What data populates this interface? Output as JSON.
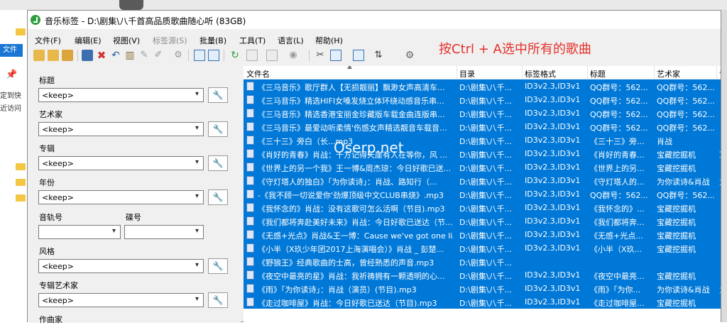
{
  "window": {
    "title": "音乐标签 - D:\\剧集\\八千首高品质歌曲随心听 (83GB)"
  },
  "menu": [
    {
      "label": "文件(F)",
      "enabled": true
    },
    {
      "label": "编辑(E)",
      "enabled": true
    },
    {
      "label": "视图(V)",
      "enabled": true
    },
    {
      "label": "标签源(S)",
      "enabled": false
    },
    {
      "label": "批量(B)",
      "enabled": true
    },
    {
      "label": "工具(T)",
      "enabled": true
    },
    {
      "label": "语言(L)",
      "enabled": true
    },
    {
      "label": "帮助(H)",
      "enabled": true
    }
  ],
  "toolbar_icons": [
    "open-folder-icon",
    "add-folder-icon",
    "folders-icon",
    "save-icon",
    "remove-icon",
    "undo-icon",
    "book-icon",
    "tag-icon",
    "pencil-icon",
    "gear-icon",
    "grid-icon",
    "table-icon",
    "refresh-icon",
    "list-icon",
    "column-icon",
    "cd-icon",
    "wrench-icon",
    "copy-icon",
    "export-icon",
    "import-icon",
    "settings-icon"
  ],
  "fields": {
    "title": {
      "label": "标题",
      "value": "<keep>"
    },
    "artist": {
      "label": "艺术家",
      "value": "<keep>"
    },
    "album": {
      "label": "专辑",
      "value": "<keep>"
    },
    "year": {
      "label": "年份",
      "value": "<keep>"
    },
    "track": {
      "label": "音轨号"
    },
    "disc": {
      "label": "碟号"
    },
    "genre": {
      "label": "风格",
      "value": "<keep>"
    },
    "album_artist": {
      "label": "专辑艺术家",
      "value": "<keep>"
    },
    "composer": {
      "label": "作曲家"
    }
  },
  "filelist": {
    "columns": [
      "文件名",
      "目录",
      "标签格式",
      "标题",
      "艺术家",
      "专"
    ],
    "rows": [
      {
        "name": "《三马音乐》歌厅群人【无损靓丽】飘渺女声高清车...",
        "dir": "D:\\剧集\\八千...",
        "fmt": "ID3v2.3,ID3v1",
        "title": "QQ群号：562...",
        "artist": "QQ群号：562...",
        "album": "",
        "selected": true
      },
      {
        "name": "《三马音乐》精选HIFI女嗓发烧立体环绕动感音乐串...",
        "dir": "D:\\剧集\\八千...",
        "fmt": "ID3v2.3,ID3v1",
        "title": "QQ群号：562...",
        "artist": "QQ群号：562...",
        "album": "",
        "selected": true
      },
      {
        "name": "《三马音乐》精选香港宝丽金珍藏版车载金曲连版串...",
        "dir": "D:\\剧集\\八千...",
        "fmt": "ID3v2.3,ID3v1",
        "title": "QQ群号：562...",
        "artist": "QQ群号：562...",
        "album": "",
        "selected": true
      },
      {
        "name": "《三马音乐》最爱动听柔情'伤感女声精选靓音车载音...",
        "dir": "D:\\剧集\\八千...",
        "fmt": "ID3v2.3,ID3v1",
        "title": "QQ群号：562...",
        "artist": "QQ群号：562...",
        "album": "",
        "selected": true
      },
      {
        "name": "《三十三》旁白（长...mp3",
        "dir": "D:\\剧集\\八千...",
        "fmt": "ID3v2.3,ID3v1",
        "title": "《三十三》旁...",
        "artist": "肖战",
        "album": "",
        "selected": true
      },
      {
        "name": "《肖好的青春》肖战：千方记得天崖有人在等你，风 ...",
        "dir": "D:\\剧集\\八千...",
        "fmt": "ID3v2.3,ID3v1",
        "title": "《肖好的青春...",
        "artist": "宝藏挖掘机",
        "album": "耳",
        "selected": true
      },
      {
        "name": "《世界上的另一个我》王一博&周杰琼：今日好歌已送...",
        "dir": "D:\\剧集\\八千...",
        "fmt": "ID3v2.3,ID3v1",
        "title": "《世界上的另...",
        "artist": "宝藏挖掘机",
        "album": "",
        "selected": true
      },
      {
        "name": "《守灯塔人的独白》「为你读诗」：肖战、路知行（...",
        "dir": "D:\\剧集\\八千...",
        "fmt": "ID3v2.3,ID3v1",
        "title": "《守灯塔人的...",
        "artist": "为你读诗&肖战",
        "album": "为",
        "selected": true
      },
      {
        "name": "-《我不顾一切说爱你'劲爆顶级中文CLUB串烧》.mp3",
        "dir": "D:\\剧集\\八千...",
        "fmt": "ID3v2.3,ID3v1",
        "title": "QQ群号：562...",
        "artist": "QQ群号：562...",
        "album": "",
        "selected": true
      },
      {
        "name": "《我怀念的》肖战：没有这歌可怎么活啊（节目).mp3",
        "dir": "D:\\剧集\\八千...",
        "fmt": "ID3v2.3,ID3v1",
        "title": "《我怀念的》...",
        "artist": "宝藏挖掘机",
        "album": "",
        "selected": true
      },
      {
        "name": "《我们都将奔赴美好未来》肖战：今日好歌已送达（节...",
        "dir": "D:\\剧集\\八千...",
        "fmt": "ID3v2.3,ID3v1",
        "title": "《我们都将奔...",
        "artist": "宝藏挖掘机",
        "album": "",
        "selected": true
      },
      {
        "name": "《无感+光点》肖战&王一博：Cause we've got one li...",
        "dir": "D:\\剧集\\八千...",
        "fmt": "ID3v2.3,ID3v1",
        "title": "《无感+光点...",
        "artist": "宝藏挖掘机",
        "album": "",
        "selected": true
      },
      {
        "name": "《小半（X玖少年团2017上海演唱会）》肖战 _ 彭楚...",
        "dir": "D:\\剧集\\八千...",
        "fmt": "ID3v2.3,ID3v1",
        "title": "《小半（X玖...",
        "artist": "宝藏挖掘机",
        "album": "",
        "selected": true
      },
      {
        "name": "《野狼王》经典歌曲的士高，曾经熟悉的声音.mp3",
        "dir": "D:\\剧集\\八千...",
        "fmt": "",
        "title": "",
        "artist": "",
        "album": "",
        "selected": true
      },
      {
        "name": "《夜空中最亮的星》肖战：我祈祷拥有一颗透明的心...",
        "dir": "D:\\剧集\\八千...",
        "fmt": "ID3v2.3,ID3v1",
        "title": "《夜空中最亮...",
        "artist": "宝藏挖掘机",
        "album": "",
        "selected": true
      },
      {
        "name": "《雨》「为你读诗」：肖战（演员）(节目).mp3",
        "dir": "D:\\剧集\\八千...",
        "fmt": "ID3v2.3,ID3v1",
        "title": "《雨》「为你...",
        "artist": "为你读诗&肖战",
        "album": "为",
        "selected": true
      },
      {
        "name": "《走过咖啡屋》肖战：今日好歌已送达（节目).mp3",
        "dir": "D:\\剧集\\八千...",
        "fmt": "ID3v2.3,ID3v1",
        "title": "《走过咖啡屋...",
        "artist": "宝藏挖掘机",
        "album": "",
        "selected": true
      }
    ]
  },
  "annotation": "按Ctrl + A选中所有的歌曲",
  "watermark": "Oserp.net",
  "background": {
    "file_label": "文件",
    "sidebar_text_1": "定到快",
    "sidebar_text_2": "近访问"
  },
  "colors": {
    "selection": "#0078d7",
    "annotation": "#e5312b"
  }
}
